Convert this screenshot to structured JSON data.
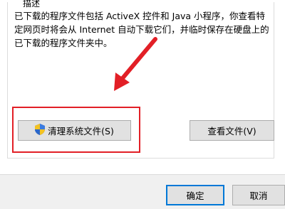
{
  "group": {
    "title": "描述",
    "description": "已下载的程序文件包括 ActiveX 控件和 Java 小程序，你查看特定网页时将会从 Internet 自动下载它们，并临时保存在硬盘上的已下载的程序文件夹中。"
  },
  "buttons": {
    "clean": "清理系统文件(S)",
    "view": "查看文件(V)",
    "ok": "确定",
    "cancel": "取消"
  },
  "icons": {
    "clean": "uac-shield-icon"
  },
  "colors": {
    "annotation": "#e21f26",
    "focus_border": "#0078d7"
  }
}
